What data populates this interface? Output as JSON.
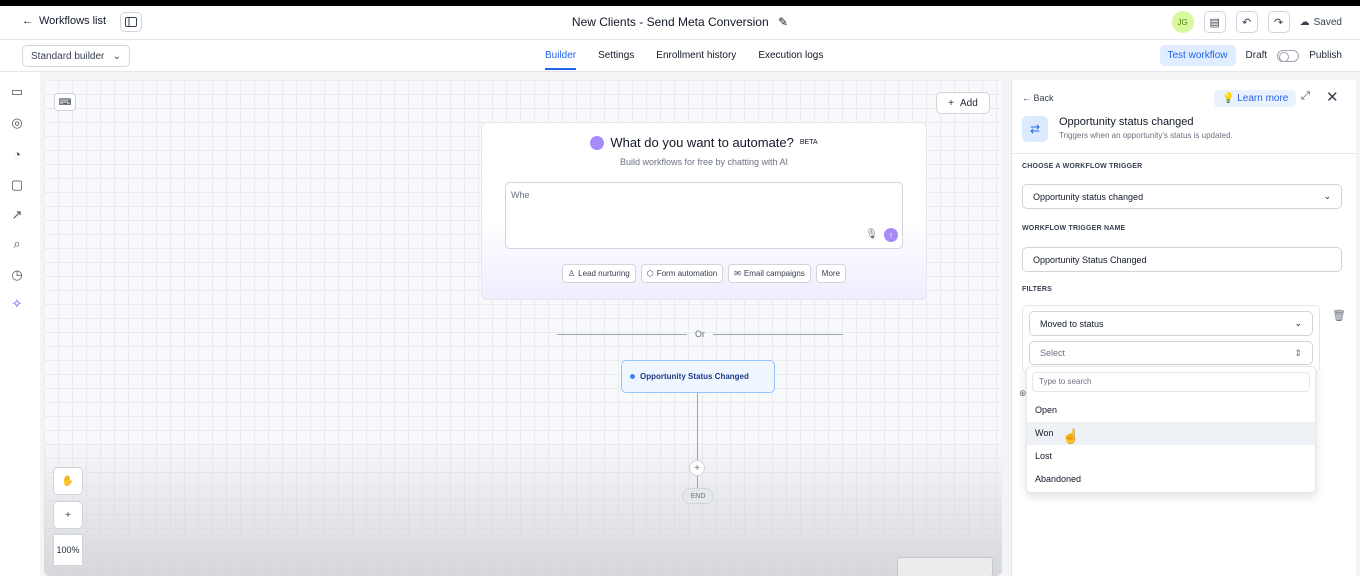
{
  "header": {
    "back_label": "Workflows list",
    "title": "New Clients - Send Meta Conversion",
    "avatar_initials": "JG",
    "saved_label": "Saved"
  },
  "subbar": {
    "builder_select": "Standard builder",
    "tabs": [
      "Builder",
      "Settings",
      "Enrollment history",
      "Execution logs"
    ],
    "test_workflow": "Test workflow",
    "draft_label": "Draft",
    "publish_label": "Publish"
  },
  "canvas": {
    "add_label": "Add",
    "ai_title": "What do you want to automate?",
    "ai_badge": "BETA",
    "ai_subtitle": "Build workflows for free by chatting with AI",
    "ai_input_value": "Whe",
    "chips": [
      "Lead nurturing",
      "Form automation",
      "Email campaigns",
      "More"
    ],
    "or_label": "Or",
    "trigger_node_label": "Opportunity Status Changed",
    "end_label": "END",
    "zoom_level": "100%"
  },
  "panel": {
    "back_label": "Back",
    "learn_more": "Learn more",
    "trigger_title": "Opportunity status changed",
    "trigger_desc": "Triggers when an opportunity's status is updated.",
    "choose_trigger_heading": "CHOOSE A WORKFLOW TRIGGER",
    "choose_trigger_value": "Opportunity status changed",
    "trigger_name_heading": "WORKFLOW TRIGGER NAME",
    "trigger_name_value": "Opportunity Status Changed",
    "filters_heading": "FILTERS",
    "filter_type_value": "Moved to status",
    "filter_value_placeholder": "Select",
    "dropdown_search_placeholder": "Type to search",
    "dropdown_options": [
      "Open",
      "Won",
      "Lost",
      "Abandoned"
    ]
  },
  "colors": {
    "accent": "#2563eb",
    "ai_purple": "#a78bfa",
    "trigger_bg": "#eff6ff"
  }
}
